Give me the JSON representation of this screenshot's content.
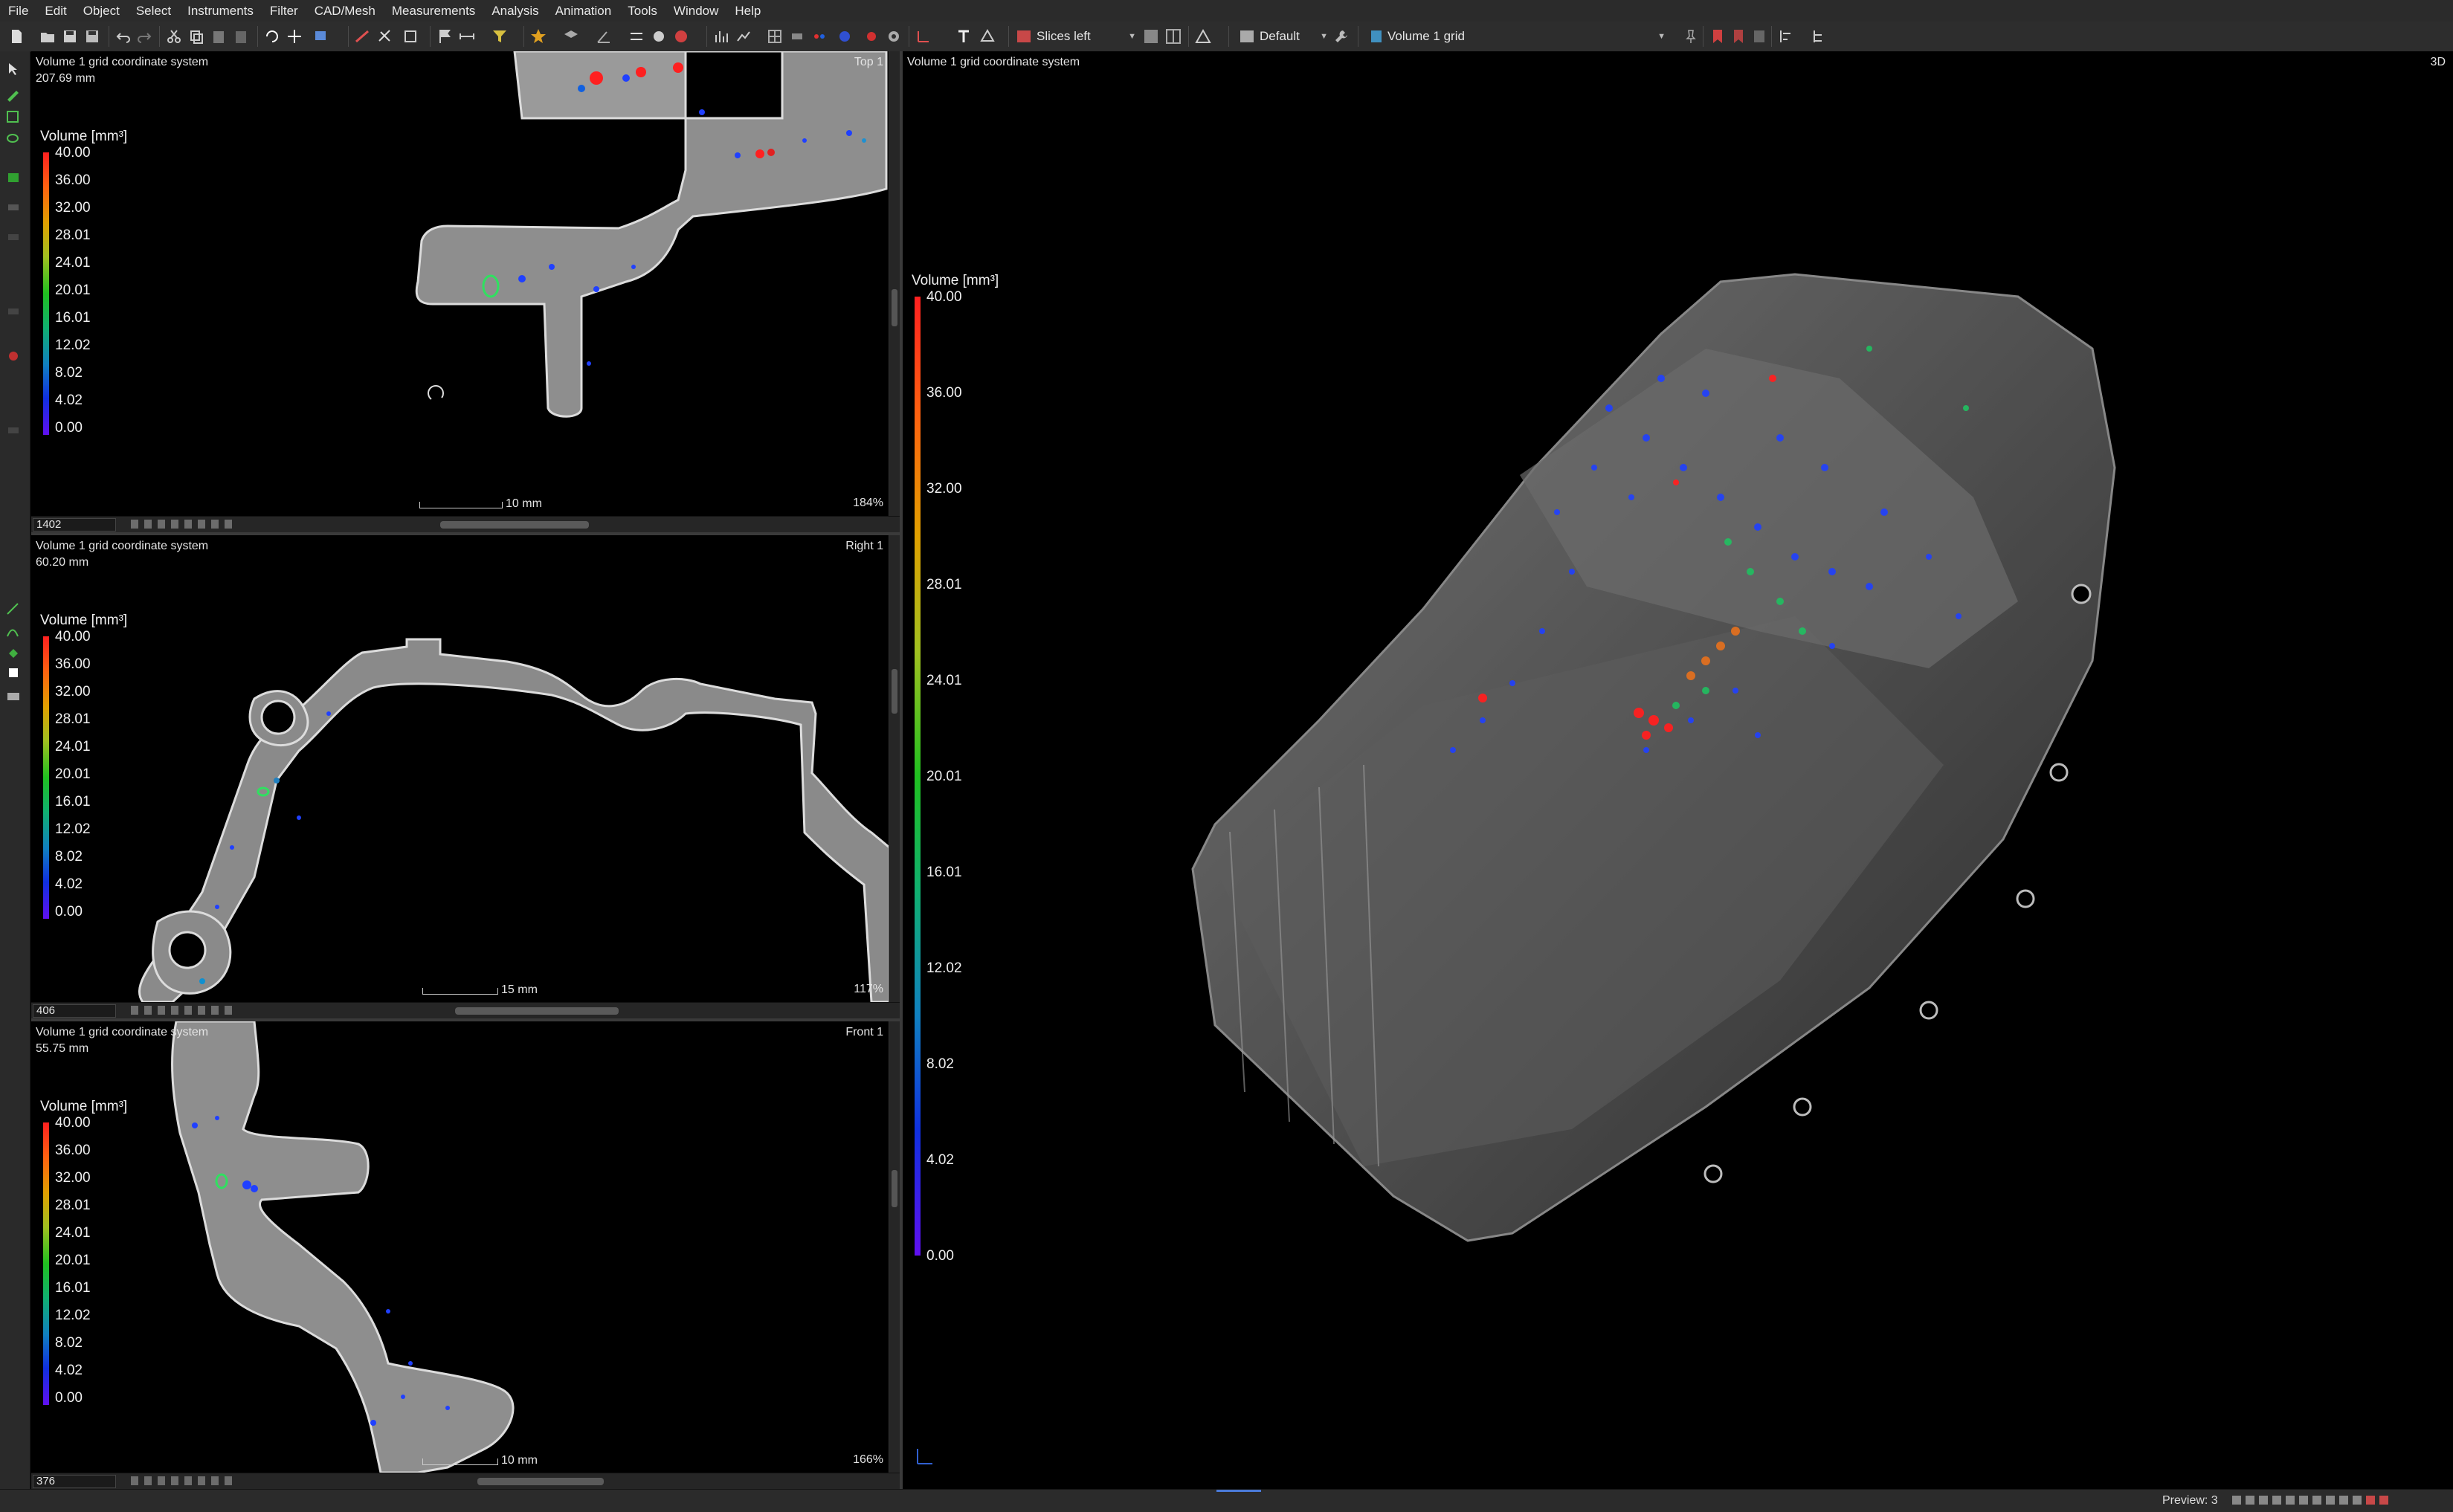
{
  "menu": [
    "File",
    "Edit",
    "Object",
    "Select",
    "Instruments",
    "Filter",
    "CAD/Mesh",
    "Measurements",
    "Analysis",
    "Animation",
    "Tools",
    "Window",
    "Help"
  ],
  "toolbar": {
    "layout_combo": "Slices left",
    "profile_combo": "Default",
    "object_combo": "Volume 1 grid"
  },
  "legend": {
    "title": "Volume [mm³]",
    "ticks": [
      "40.00",
      "36.00",
      "32.00",
      "28.01",
      "24.01",
      "20.01",
      "16.01",
      "12.02",
      "8.02",
      "4.02",
      "0.00"
    ]
  },
  "views": {
    "top": {
      "title": "Volume 1 grid coordinate system",
      "depth": "207.69 mm",
      "label": "Top 1",
      "scale": "10 mm",
      "zoom": "184%",
      "slice": "1402"
    },
    "right": {
      "title": "Volume 1 grid coordinate system",
      "depth": "60.20 mm",
      "label": "Right 1",
      "scale": "15 mm",
      "zoom": "117%",
      "slice": "406"
    },
    "front": {
      "title": "Volume 1 grid coordinate system",
      "depth": "55.75 mm",
      "label": "Front 1",
      "scale": "10 mm",
      "zoom": "166%",
      "slice": "376"
    },
    "three_d": {
      "title": "Volume 1 grid coordinate system",
      "label": "3D"
    }
  },
  "status": {
    "preview": "Preview: 3"
  },
  "colors": {
    "background": "#000000",
    "panel": "#2b2b2b",
    "part_gray": "#8c8c8c"
  }
}
